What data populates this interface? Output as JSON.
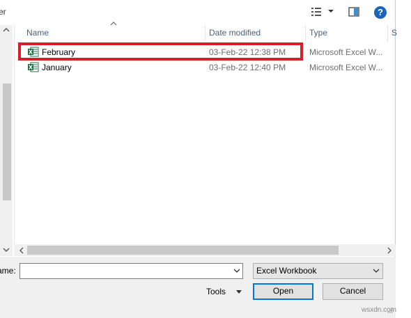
{
  "toolbar": {
    "partial_label": "er"
  },
  "columns": {
    "name": "Name",
    "date": "Date modified",
    "type": "Type",
    "size": "S"
  },
  "files": [
    {
      "name": "February",
      "date": "03-Feb-22 12:38 PM",
      "type": "Microsoft Excel W...",
      "highlighted": true
    },
    {
      "name": "January",
      "date": "03-Feb-22 12:40 PM",
      "type": "Microsoft Excel W...",
      "highlighted": false
    }
  ],
  "bottom": {
    "filename_label": "ame:",
    "filename_value": "",
    "filetype_value": "Excel Workbook",
    "tools_label": "Tools",
    "open_label": "Open",
    "cancel_label": "Cancel"
  },
  "watermark": "wsxdn.com",
  "colors": {
    "highlight": "#d3202c",
    "excel_green": "#1e7145",
    "accent": "#0078d7",
    "help_blue": "#1a65b8"
  }
}
